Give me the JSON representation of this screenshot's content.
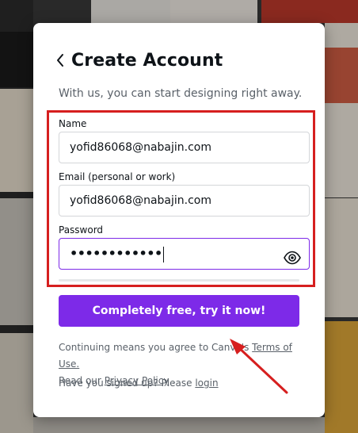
{
  "modal": {
    "title": "Create Account",
    "subtitle": "With us, you can start designing right away."
  },
  "form": {
    "name_label": "Name",
    "name_value": "yofid86068@nabajin.com",
    "email_label": "Email (personal or work)",
    "email_value": "yofid86068@nabajin.com",
    "password_label": "Password",
    "password_masked": "••••••••••••"
  },
  "cta": {
    "label": "Completely free, try it now!"
  },
  "legal": {
    "prefix": "Continuing means you agree to Canva's",
    "terms_link": "Terms of Use.",
    "read_our": "Read our",
    "privacy_link": "Privacy Policy",
    "suffix": "."
  },
  "signin": {
    "prompt": "Have you signed up? Please",
    "link": "login"
  },
  "colors": {
    "brand_purple": "#7d2ae8",
    "annotation_red": "#d61f1f"
  },
  "icons": [
    "chevron-left-icon",
    "eye-icon"
  ]
}
